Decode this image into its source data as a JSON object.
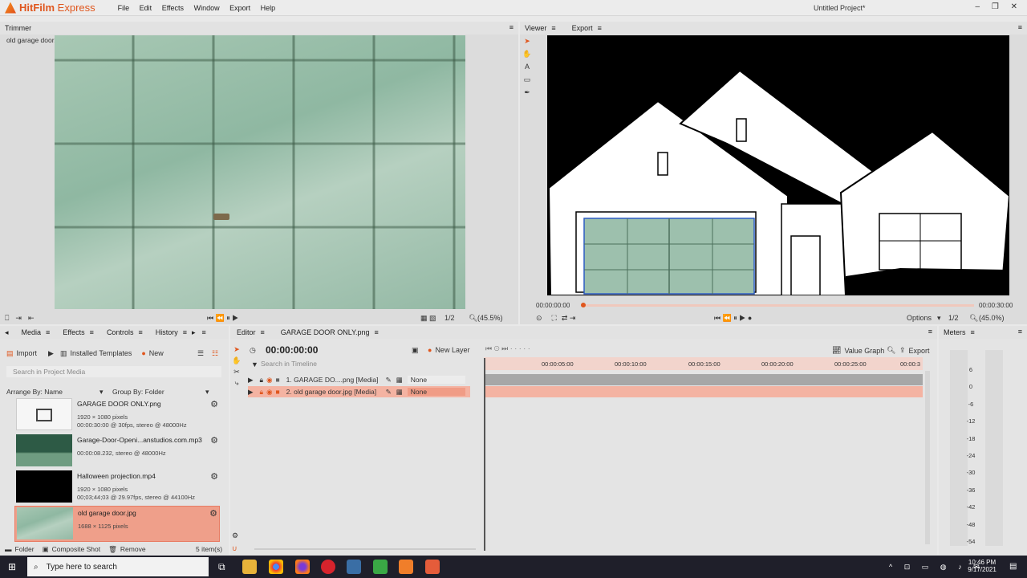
{
  "app": {
    "name_bold": "HitFilm",
    "name_rest": " Express",
    "menu": [
      "File",
      "Edit",
      "Effects",
      "Window",
      "Export",
      "Help"
    ],
    "project_title": "Untitled Project*",
    "win_controls": "–  ❐  ✕"
  },
  "trimmer": {
    "tab": "Trimmer",
    "filename": "old garage door.jpg",
    "quality": "1/2",
    "zoom": "(45.5%)"
  },
  "viewer": {
    "tabs": [
      "Viewer",
      "Export"
    ],
    "time_start": "00:00:00:00",
    "time_end": "00:00:30:00",
    "options": "Options",
    "quality": "1/2",
    "zoom": "(45.0%)"
  },
  "media": {
    "tabs": [
      "Media",
      "Effects",
      "Controls",
      "History"
    ],
    "import": "Import",
    "templates": "Installed Templates",
    "new": "New",
    "search_placeholder": "Search in Project Media",
    "arrange": "Arrange By: Name",
    "group": "Group By: Folder",
    "items": [
      {
        "name": "GARAGE DOOR ONLY.png",
        "d1": "1920 × 1080 pixels",
        "d2": "00:00:30:00 @ 30fps, stereo @ 48000Hz"
      },
      {
        "name": "Garage-Door-Openi...anstudios.com.mp3",
        "d1": "00:00:08.232, stereo @ 48000Hz",
        "d2": ""
      },
      {
        "name": "Halloween projection.mp4",
        "d1": "1920 × 1080 pixels",
        "d2": "00;03;44;03 @ 29.97fps, stereo @ 44100Hz"
      },
      {
        "name": "old garage door.jpg",
        "d1": "1688 × 1125 pixels",
        "d2": ""
      }
    ],
    "folder": "Folder",
    "composite": "Composite Shot",
    "remove": "Remove",
    "count": "5 item(s)"
  },
  "editor": {
    "tabs": [
      "Editor",
      "GARAGE DOOR ONLY.png"
    ],
    "timecode": "00:00:00:00",
    "new_layer": "New Layer",
    "search_placeholder": "Search in Timeline",
    "value_graph": "Value Graph",
    "export": "Export",
    "ruler": [
      "00:00:05:00",
      "00:00:10:00",
      "00:00:15:00",
      "00:00:20:00",
      "00:00:25:00",
      "00:00:3"
    ],
    "layers": [
      {
        "name": "1. GARAGE DO....png [Media]",
        "blend": "None"
      },
      {
        "name": "2. old garage door.jpg [Media]",
        "blend": "None"
      }
    ]
  },
  "meters": {
    "tab": "Meters",
    "scale": [
      "6",
      "0",
      "-6",
      "-12",
      "-18",
      "-24",
      "-30",
      "-36",
      "-42",
      "-48",
      "-54"
    ]
  },
  "taskbar": {
    "search": "Type here to search",
    "time": "10:46 PM",
    "date": "9/17/2021"
  }
}
